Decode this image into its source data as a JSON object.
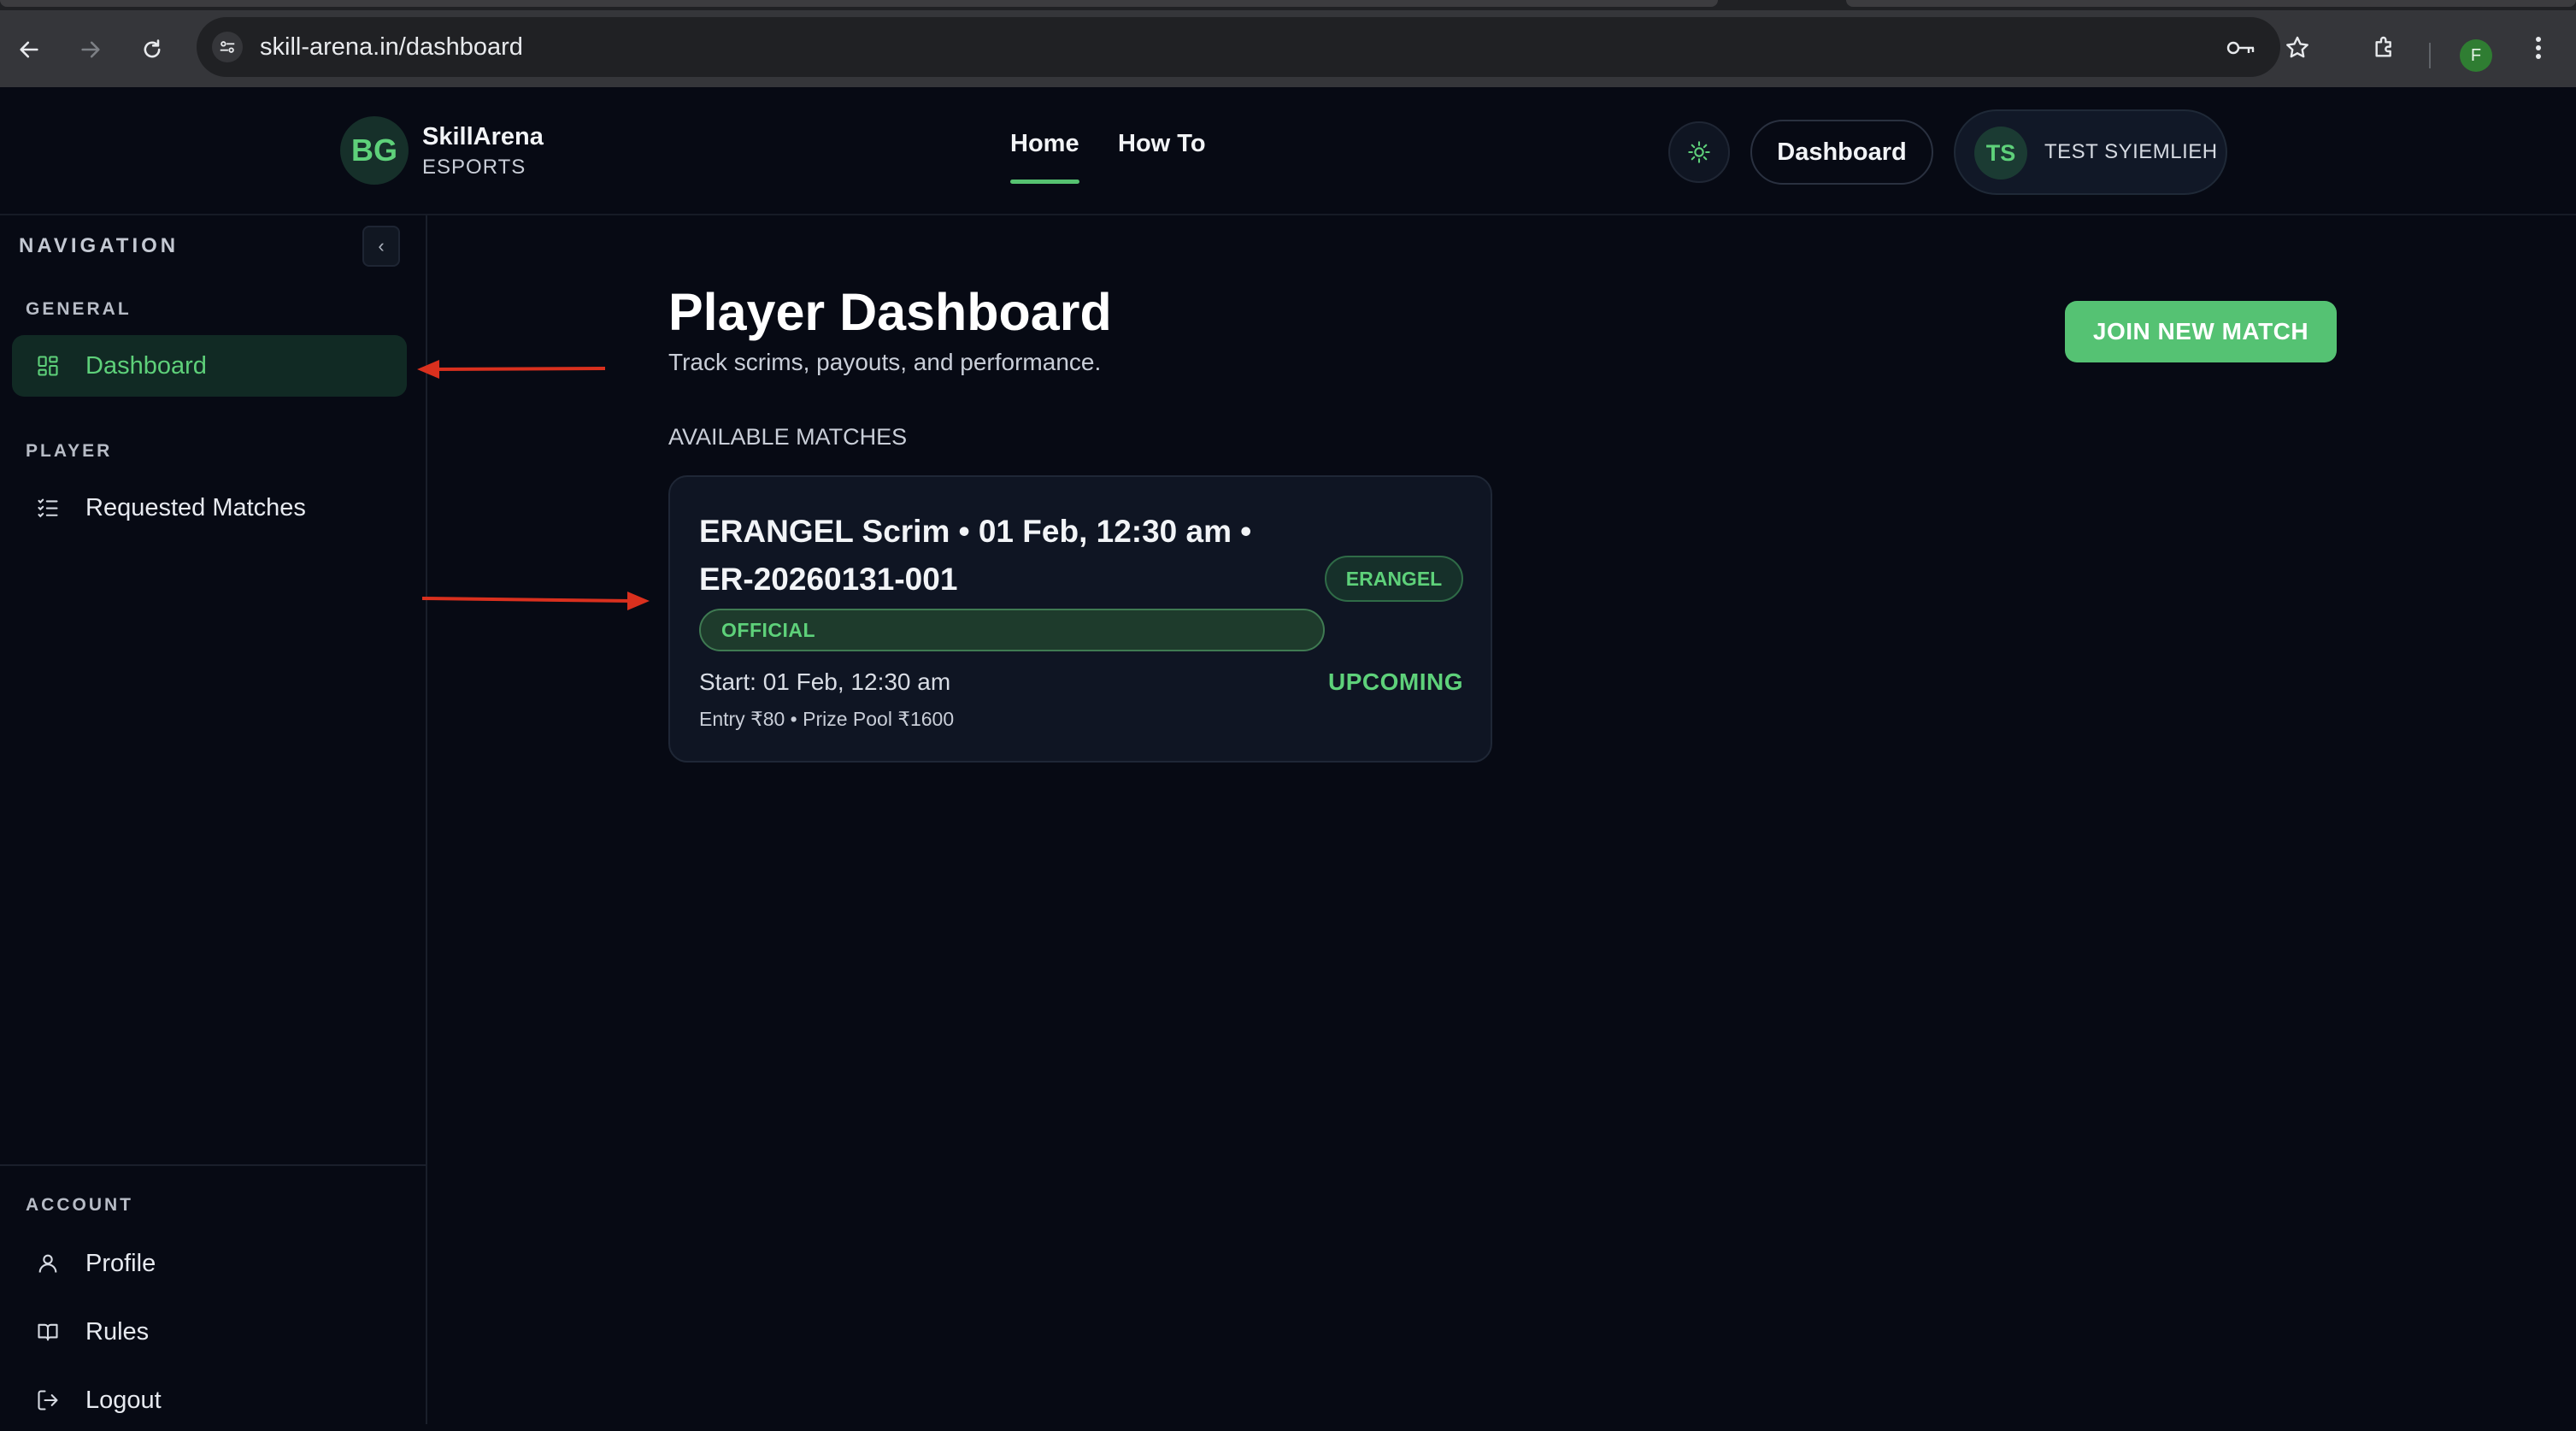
{
  "browser": {
    "url": "skill-arena.in/dashboard",
    "profile_initial": "F"
  },
  "header": {
    "brand_logo": "BG",
    "brand_name": "SkillArena",
    "brand_sub": "ESPORTS",
    "nav": [
      {
        "label": "Home",
        "active": true
      },
      {
        "label": "How To",
        "active": false
      }
    ],
    "dashboard_button": "Dashboard",
    "user_initials": "TS",
    "user_name": "TEST SYIEMLIEH"
  },
  "sidebar": {
    "heading": "NAVIGATION",
    "sections": [
      {
        "title": "GENERAL",
        "items": [
          {
            "label": "Dashboard",
            "icon": "grid-icon",
            "active": true
          }
        ]
      },
      {
        "title": "PLAYER",
        "items": [
          {
            "label": "Requested Matches",
            "icon": "checklist-icon",
            "active": false
          }
        ]
      },
      {
        "title": "ACCOUNT",
        "items": [
          {
            "label": "Profile",
            "icon": "user-icon"
          },
          {
            "label": "Rules",
            "icon": "book-icon"
          },
          {
            "label": "Logout",
            "icon": "logout-icon"
          }
        ]
      }
    ]
  },
  "main": {
    "title": "Player Dashboard",
    "subtitle": "Track scrims, payouts, and performance.",
    "join_button": "JOIN NEW MATCH",
    "section_label": "AVAILABLE MATCHES",
    "match": {
      "title": "ERANGEL Scrim • 01 Feb, 12:30 am • ER-20260131-001",
      "map": "ERANGEL",
      "type": "OFFICIAL",
      "start": "Start: 01 Feb, 12:30 am",
      "status": "UPCOMING",
      "entry": "Entry ₹80 • Prize Pool ₹1600"
    }
  },
  "colors": {
    "accent": "#55c273",
    "background": "#070a14",
    "card": "#0f1523",
    "annotation_arrow": "#d9301e"
  }
}
